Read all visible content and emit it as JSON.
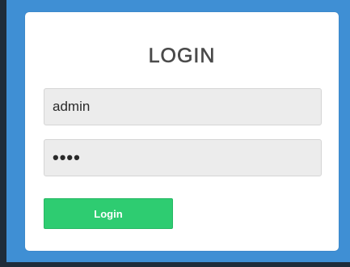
{
  "login": {
    "title": "LOGIN",
    "username_value": "admin",
    "password_value": "••••",
    "submit_label": "Login"
  },
  "colors": {
    "page_background": "#3f8fd4",
    "card_background": "#ffffff",
    "input_background": "#ececec",
    "button_background": "#2ecc71",
    "title_text": "#4a4a4a"
  }
}
